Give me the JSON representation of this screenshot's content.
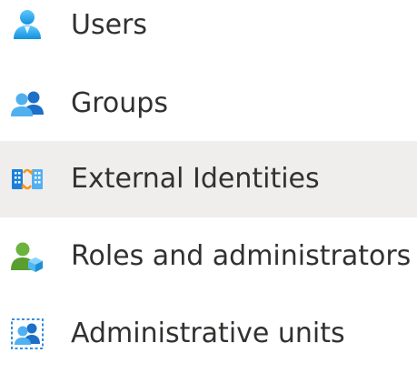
{
  "nav": {
    "items": [
      {
        "label": "Users",
        "icon": "user-icon",
        "selected": false
      },
      {
        "label": "Groups",
        "icon": "groups-icon",
        "selected": false
      },
      {
        "label": "External Identities",
        "icon": "external-identities-icon",
        "selected": true
      },
      {
        "label": "Roles and administrators",
        "icon": "roles-icon",
        "selected": false
      },
      {
        "label": "Administrative units",
        "icon": "administrative-units-icon",
        "selected": false
      }
    ]
  },
  "colors": {
    "selected_background": "#efeeed",
    "text": "#323130",
    "icon_blue": "#0078d4",
    "icon_light_blue": "#50b0f2",
    "icon_green": "#5db300",
    "icon_orange": "#f7941d"
  }
}
